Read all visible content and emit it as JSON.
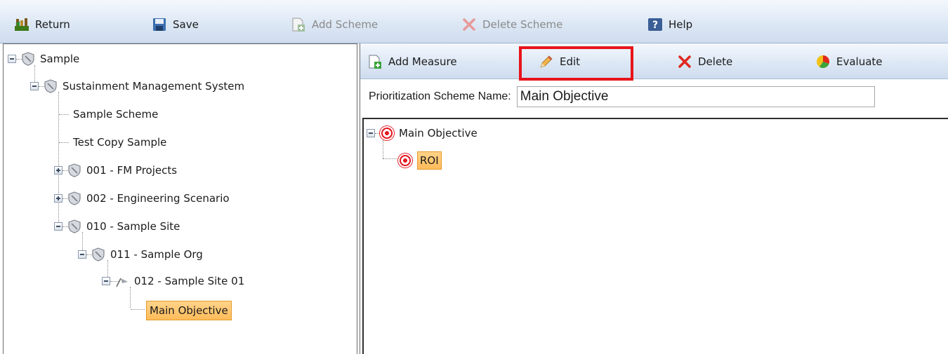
{
  "toolbar": {
    "return_label": "Return",
    "save_label": "Save",
    "add_scheme_label": "Add Scheme",
    "delete_scheme_label": "Delete Scheme",
    "help_label": "Help"
  },
  "tree": {
    "nodes": [
      {
        "label": "Sample",
        "icon": "shield-icon",
        "expanded": true
      },
      {
        "label": "Sustainment Management System",
        "icon": "shield-icon",
        "expanded": true
      },
      {
        "label": "Sample Scheme"
      },
      {
        "label": "Test Copy Sample"
      },
      {
        "label": "001 - FM Projects",
        "icon": "shield-icon",
        "expanded": false
      },
      {
        "label": "002 - Engineering Scenario",
        "icon": "shield-icon",
        "expanded": false
      },
      {
        "label": "010 - Sample Site",
        "icon": "shield-icon",
        "expanded": true
      },
      {
        "label": "011 - Sample Org",
        "icon": "shield-icon",
        "expanded": true
      },
      {
        "label": "012 - Sample Site 01",
        "icon": "flag-icon",
        "expanded": true
      },
      {
        "label": "Main Objective",
        "selected": true
      }
    ]
  },
  "sub_toolbar": {
    "add_measure_label": "Add Measure",
    "edit_label": "Edit",
    "delete_label": "Delete",
    "evaluate_label": "Evaluate"
  },
  "scheme": {
    "name_label": "Prioritization Scheme Name:",
    "name_value": "Main Objective"
  },
  "objectives": {
    "root_label": "Main Objective",
    "child_label": "ROI"
  },
  "colors": {
    "highlight": "#e8141b",
    "selected_bg": "#ffc46a",
    "toolbar_bg": "#dde8f5"
  }
}
